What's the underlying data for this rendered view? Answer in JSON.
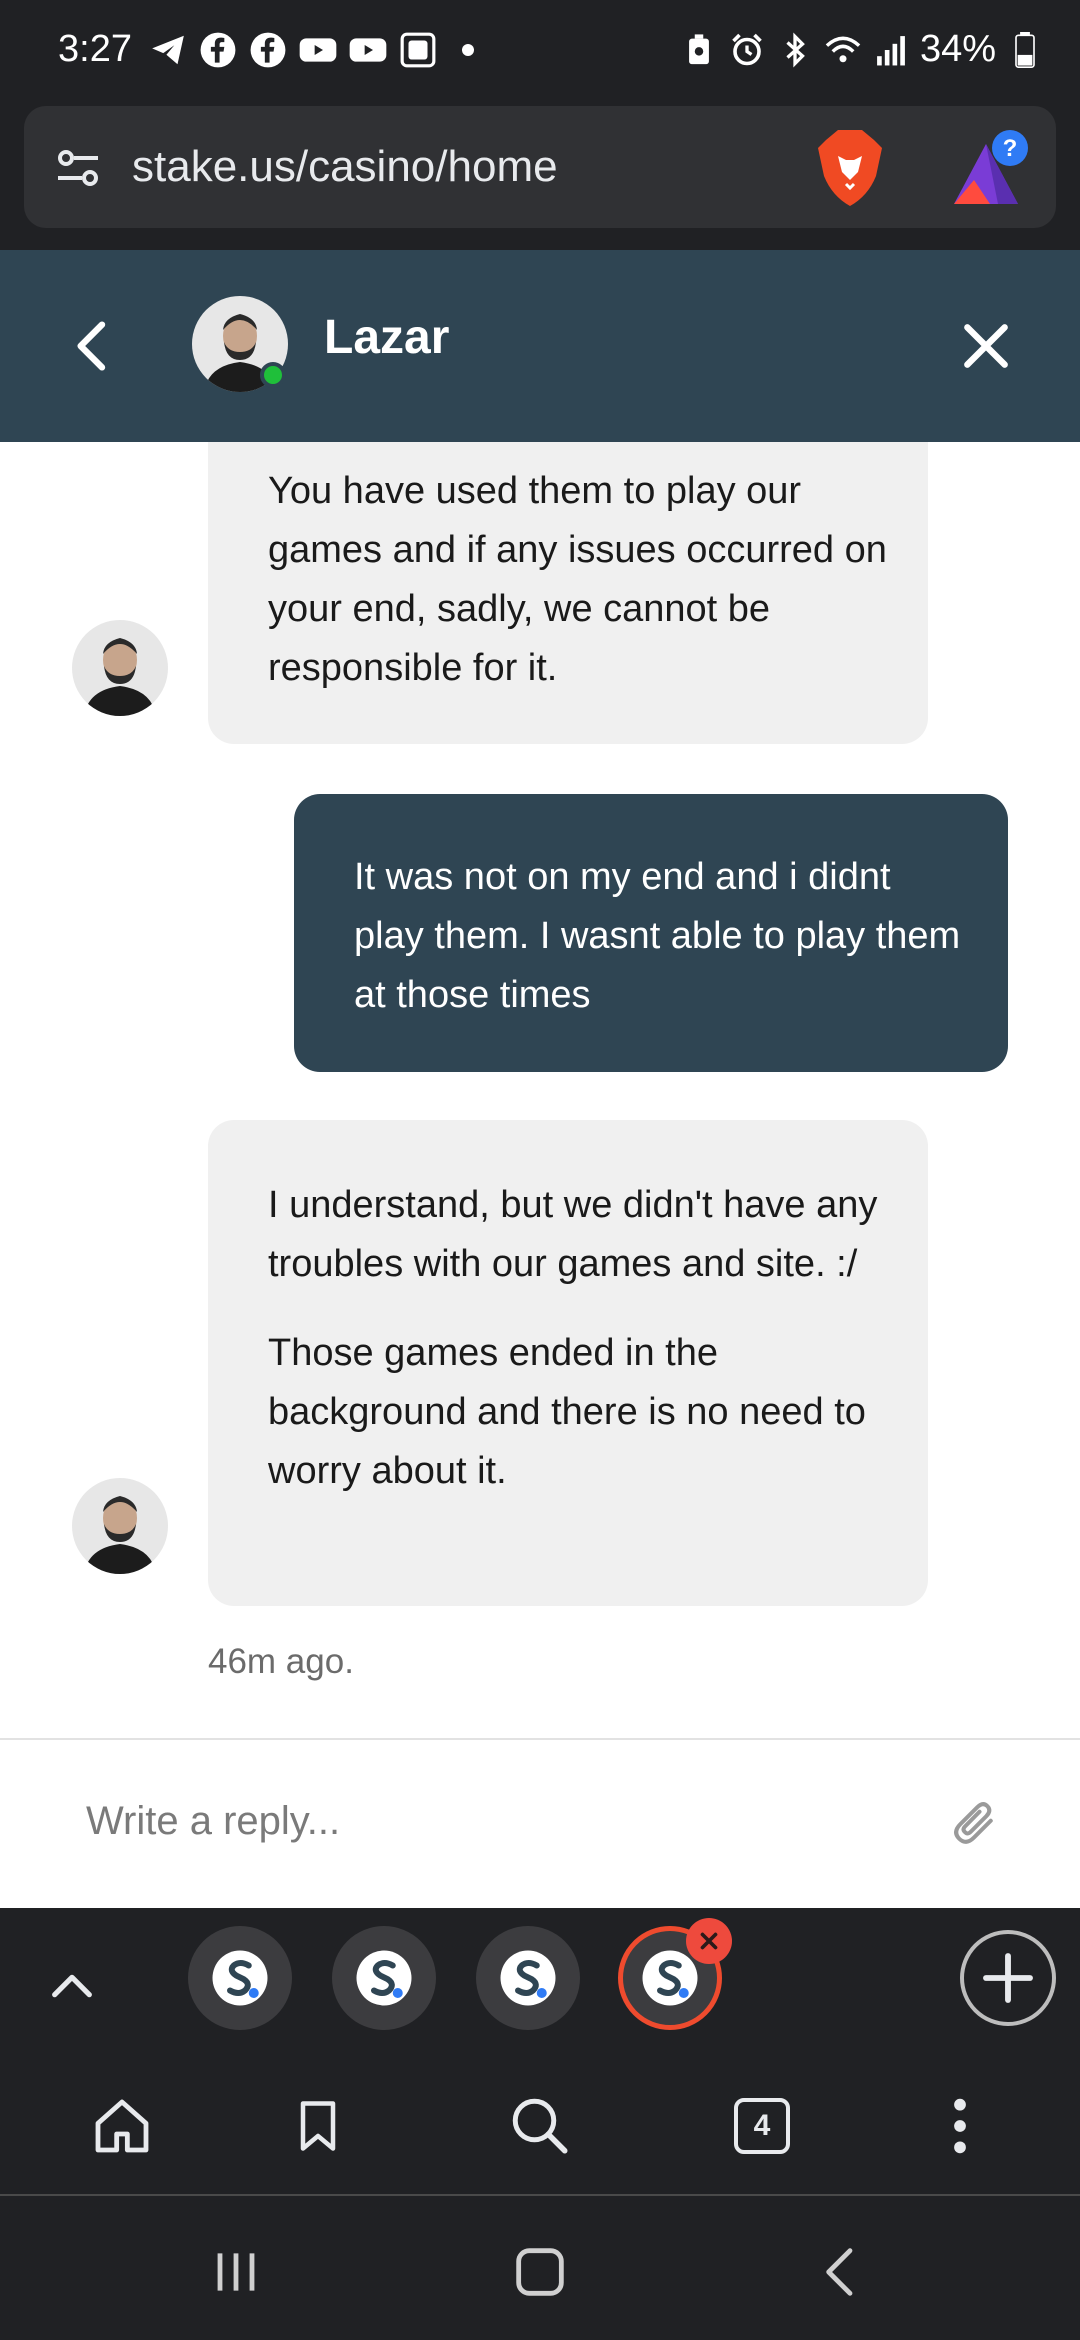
{
  "status_bar": {
    "time": "3:27",
    "battery": "34%",
    "left_icons": [
      "telegram-icon",
      "facebook-icon",
      "facebook-icon",
      "youtube-icon",
      "youtube-icon",
      "app-icon"
    ],
    "right_icons": [
      "battery-saver-icon",
      "alarm-icon",
      "bluetooth-icon",
      "wifi-icon",
      "signal-icon",
      "battery-icon"
    ]
  },
  "browser": {
    "url": "stake.us/casino/home",
    "tab_count": "4"
  },
  "chat": {
    "agent_name": "Lazar",
    "messages": [
      {
        "from": "agent",
        "paragraphs": [
          "You have used them to play our games and if any issues occurred on your end, sadly, we cannot be responsible for it."
        ]
      },
      {
        "from": "user",
        "paragraphs": [
          "It was not on my end and i didnt play them. I wasnt able to play them at those times"
        ]
      },
      {
        "from": "agent",
        "paragraphs": [
          "I understand, but we didn't have any troubles with our games and site. :/",
          "Those games ended in the background and there is no need to worry about it."
        ]
      }
    ],
    "timestamp": "46m ago.",
    "reply_placeholder": "Write a reply..."
  },
  "colors": {
    "header_bg": "#2f4553",
    "user_bubble": "#2f4553",
    "agent_bubble": "#f0f0f0",
    "online": "#1fbf3a",
    "browser_bg": "#202124",
    "active_tab_ring": "#ef4b2e"
  }
}
